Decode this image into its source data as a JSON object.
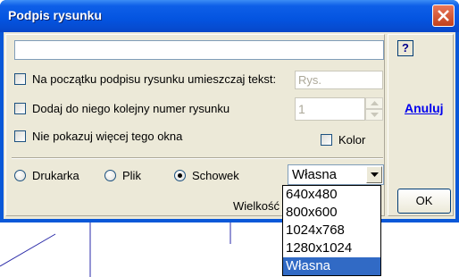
{
  "window": {
    "title": "Podpis rysunku"
  },
  "caption": {
    "value": ""
  },
  "options": {
    "prefix_label": "Na początku podpisu rysunku umieszczaj tekst:",
    "prefix_value": "Rys.",
    "number_label": "Dodaj do niego kolejny numer rysunku",
    "number_value": "1",
    "hide_label": "Nie pokazuj więcej tego okna",
    "color_label": "Kolor"
  },
  "output": {
    "printer_label": "Drukarka",
    "file_label": "Plik",
    "clipboard_label": "Schowek",
    "selected": "Schowek"
  },
  "size": {
    "label": "Wielkość",
    "selected": "Własna",
    "options": [
      "640x480",
      "800x600",
      "1024x768",
      "1280x1024",
      "Własna"
    ]
  },
  "buttons": {
    "help": "?",
    "cancel": "Anuluj",
    "ok": "OK"
  },
  "colors": {
    "title_bar": "#0454e0",
    "dialog_bg": "#ece9d8",
    "selection": "#316ac5",
    "link": "#0000ee"
  }
}
